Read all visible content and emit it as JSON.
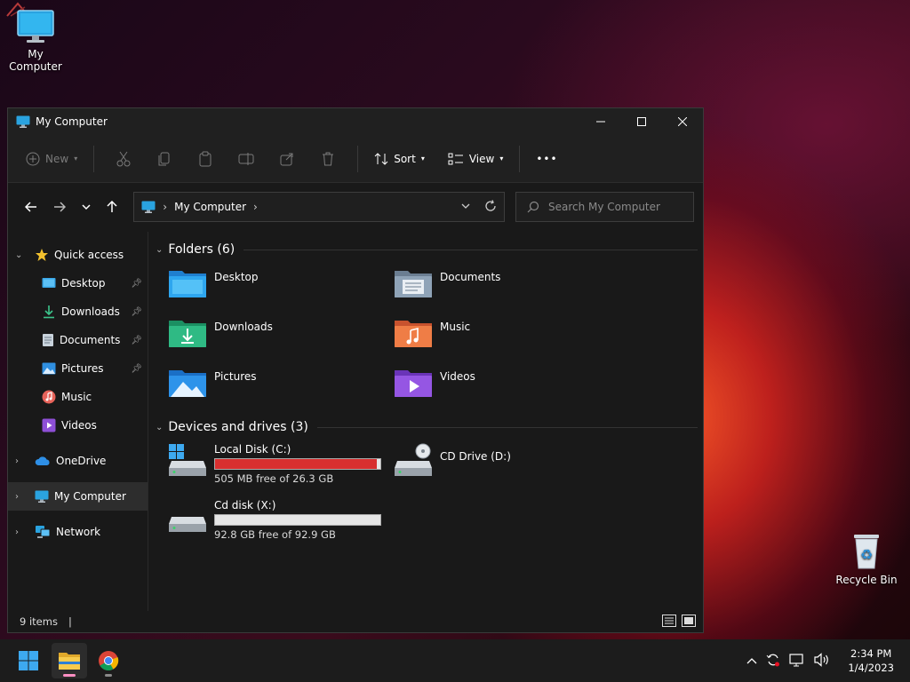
{
  "desktop": {
    "icons": [
      {
        "label": "My Computer"
      },
      {
        "label": "Recycle Bin"
      }
    ]
  },
  "window": {
    "title": "My Computer",
    "toolbar": {
      "new_label": "New",
      "sort_label": "Sort",
      "view_label": "View",
      "more_label": "•••"
    },
    "address": {
      "crumb": "My Computer"
    },
    "search": {
      "placeholder": "Search My Computer"
    },
    "sidebar": {
      "quick_access": "Quick access",
      "items": [
        {
          "label": "Desktop",
          "icon": "desktop-icon"
        },
        {
          "label": "Downloads",
          "icon": "download-icon"
        },
        {
          "label": "Documents",
          "icon": "document-icon"
        },
        {
          "label": "Pictures",
          "icon": "pictures-icon"
        },
        {
          "label": "Music",
          "icon": "music-icon"
        },
        {
          "label": "Videos",
          "icon": "videos-icon"
        }
      ],
      "onedrive": "OneDrive",
      "mycomputer": "My Computer",
      "network": "Network"
    },
    "folders": {
      "header": "Folders (6)",
      "items": [
        {
          "label": "Desktop"
        },
        {
          "label": "Documents"
        },
        {
          "label": "Downloads"
        },
        {
          "label": "Music"
        },
        {
          "label": "Pictures"
        },
        {
          "label": "Videos"
        }
      ]
    },
    "drives": {
      "header": "Devices and drives (3)",
      "items": [
        {
          "label": "Local Disk (C:)",
          "size": "505 MB free of 26.3 GB",
          "used_fraction": 0.98,
          "bar_color": "#d82f2f"
        },
        {
          "label": "CD Drive (D:)"
        },
        {
          "label": "Cd disk (X:)",
          "size": "92.8 GB free of 92.9 GB",
          "used_fraction": 0.0,
          "bar_color": "#26a0da"
        }
      ]
    },
    "status": {
      "count": "9 items"
    }
  },
  "taskbar": {
    "time": "2:34 PM",
    "date": "1/4/2023"
  }
}
